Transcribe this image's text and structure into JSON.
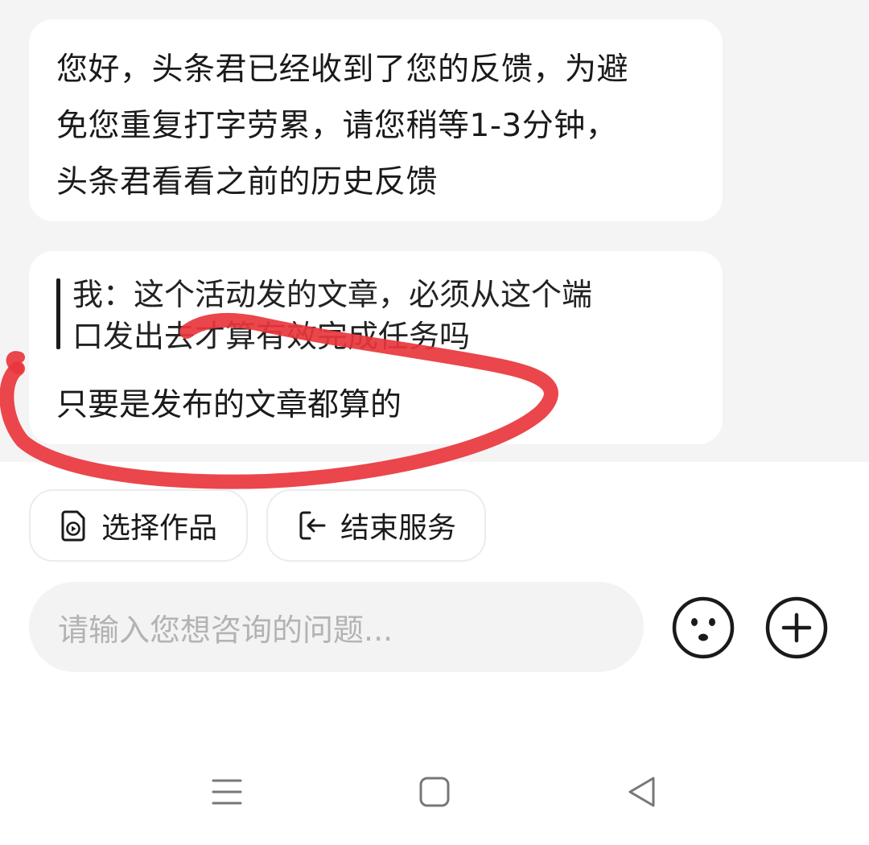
{
  "messages": {
    "bot_greeting_lines": [
      "您好，头条君已经收到了您的反馈，为避",
      "免您重复打字劳累，请您稍等1-3分钟，",
      "头条君看看之前的历史反馈"
    ],
    "quoted_lines": [
      "我：这个活动发的文章，必须从这个端",
      "口发出去才算有效完成任务吗"
    ],
    "reply": "只要是发布的文章都算的"
  },
  "actions": {
    "select_work": "选择作品",
    "end_service": "结束服务"
  },
  "input": {
    "placeholder": "请输入您想咨询的问题..."
  },
  "icons": {
    "select_work": "video-file-icon",
    "end_service": "exit-icon",
    "emoji": "smiley-icon",
    "plus": "plus-circle-icon",
    "nav_menu": "menu-icon",
    "nav_home": "square-home-icon",
    "nav_back": "triangle-back-icon"
  },
  "colors": {
    "annotation": "#e8363c",
    "chat_bg": "#f4f4f4",
    "bubble_bg": "#ffffff",
    "placeholder": "#b3b3b3"
  }
}
